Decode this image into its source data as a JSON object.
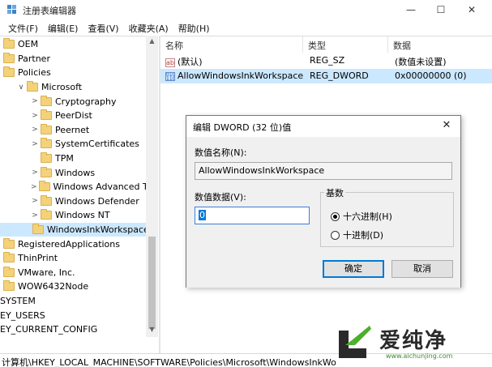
{
  "window": {
    "title": "注册表编辑器",
    "min_glyph": "—",
    "max_glyph": "☐",
    "close_glyph": "✕"
  },
  "menu": [
    "文件(F)",
    "编辑(E)",
    "查看(V)",
    "收藏夹(A)",
    "帮助(H)"
  ],
  "tree": {
    "items": [
      {
        "label": "OEM",
        "chevron": "",
        "indent": 0,
        "folder": true
      },
      {
        "label": "Partner",
        "chevron": "",
        "indent": 0,
        "folder": true
      },
      {
        "label": "Policies",
        "chevron": "",
        "indent": 0,
        "folder": true
      },
      {
        "label": "Microsoft",
        "chevron": "∨",
        "indent": 1,
        "folder": true
      },
      {
        "label": "Cryptography",
        "chevron": ">",
        "indent": 2,
        "folder": true
      },
      {
        "label": "PeerDist",
        "chevron": ">",
        "indent": 2,
        "folder": true
      },
      {
        "label": "Peernet",
        "chevron": ">",
        "indent": 2,
        "folder": true
      },
      {
        "label": "SystemCertificates",
        "chevron": ">",
        "indent": 2,
        "folder": true
      },
      {
        "label": "TPM",
        "chevron": "",
        "indent": 2,
        "folder": true
      },
      {
        "label": "Windows",
        "chevron": ">",
        "indent": 2,
        "folder": true
      },
      {
        "label": "Windows Advanced Thr",
        "chevron": ">",
        "indent": 2,
        "folder": true
      },
      {
        "label": "Windows Defender",
        "chevron": ">",
        "indent": 2,
        "folder": true
      },
      {
        "label": "Windows NT",
        "chevron": ">",
        "indent": 2,
        "folder": true
      },
      {
        "label": "WindowsInkWorkspace",
        "chevron": "",
        "indent": 2,
        "folder": true,
        "selected": true
      },
      {
        "label": "RegisteredApplications",
        "chevron": "",
        "indent": 0,
        "folder": true
      },
      {
        "label": "ThinPrint",
        "chevron": "",
        "indent": 0,
        "folder": true
      },
      {
        "label": "VMware, Inc.",
        "chevron": "",
        "indent": 0,
        "folder": true
      },
      {
        "label": "WOW6432Node",
        "chevron": "",
        "indent": 0,
        "folder": true
      },
      {
        "label": "SYSTEM",
        "chevron": "",
        "indent": -1,
        "folder": false
      },
      {
        "label": "EY_USERS",
        "chevron": "",
        "indent": -1,
        "folder": false
      },
      {
        "label": "EY_CURRENT_CONFIG",
        "chevron": "",
        "indent": -1,
        "folder": false
      }
    ]
  },
  "values_pane": {
    "headers": {
      "name": "名称",
      "type": "类型",
      "data": "数据"
    },
    "rows": [
      {
        "icon": "ab",
        "name": "(默认)",
        "type": "REG_SZ",
        "data": "(数值未设置)"
      },
      {
        "icon": "bin",
        "name": "AllowWindowsInkWorkspace",
        "type": "REG_DWORD",
        "data": "0x00000000 (0)",
        "selected": true
      }
    ]
  },
  "dialog": {
    "title": "编辑 DWORD (32 位)值",
    "close_glyph": "✕",
    "name_label": "数值名称(N):",
    "name_value": "AllowWindowsInkWorkspace",
    "data_label": "数值数据(V):",
    "data_value": "0",
    "base_label": "基数",
    "radio_hex": "十六进制(H)",
    "radio_dec": "十进制(D)",
    "ok": "确定",
    "cancel": "取消"
  },
  "statusbar": {
    "path": "计算机\\HKEY_LOCAL_MACHINE\\SOFTWARE\\Policies\\Microsoft\\WindowsInkWo"
  },
  "watermark": {
    "text": "爱纯净",
    "url": "www.aichunjing.com"
  }
}
